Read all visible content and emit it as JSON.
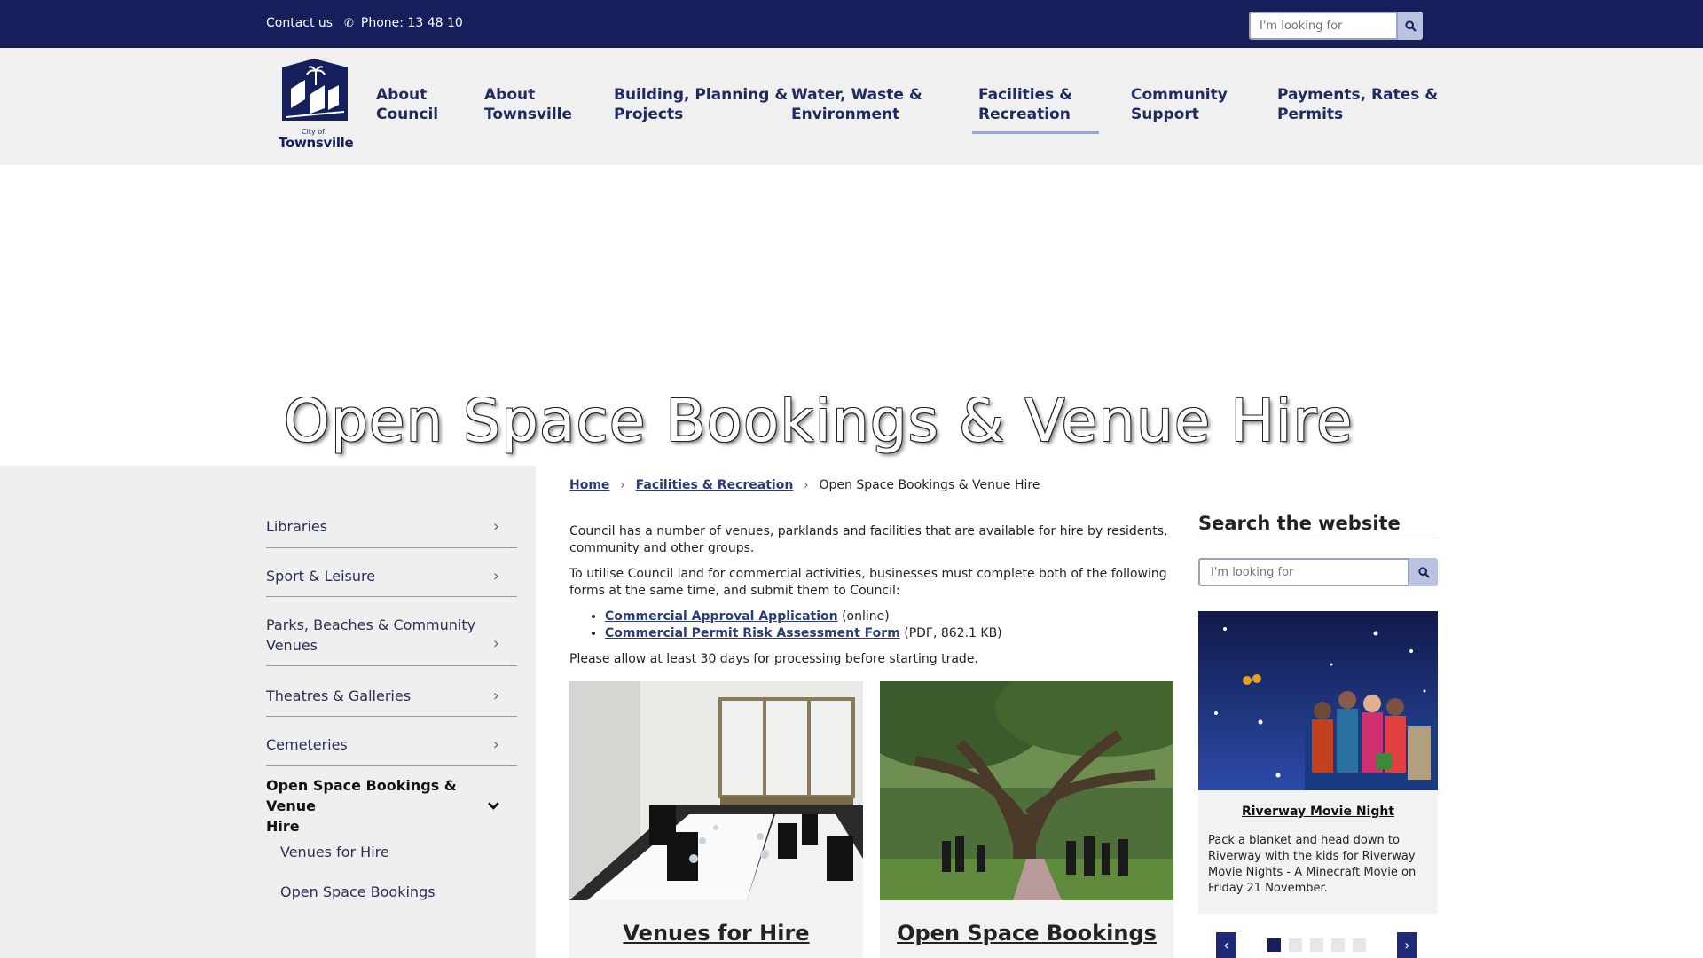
{
  "topbar": {
    "contact_label": "Contact us",
    "phone_label": "Phone: 13 48 10",
    "search_placeholder": "I'm looking for"
  },
  "logo": {
    "city_of": "City of",
    "town": "Townsville"
  },
  "nav": {
    "items": [
      {
        "line1": "About",
        "line2": "Council"
      },
      {
        "line1": "About",
        "line2": "Townsville"
      },
      {
        "line1": "Building, Planning &",
        "line2": "Projects"
      },
      {
        "line1": "Water, Waste &",
        "line2": "Environment"
      },
      {
        "line1": "Facilities &",
        "line2": "Recreation"
      },
      {
        "line1": "Community",
        "line2": "Support"
      },
      {
        "line1": "Payments, Rates &",
        "line2": "Permits"
      }
    ],
    "active_index": 4
  },
  "hero": {
    "title": "Open Space Bookings & Venue Hire"
  },
  "sidenav": {
    "items": [
      {
        "line1": "Libraries",
        "line2": ""
      },
      {
        "line1": "Sport & Leisure",
        "line2": ""
      },
      {
        "line1": "Parks, Beaches & Community",
        "line2": "Venues"
      },
      {
        "line1": "Theatres & Galleries",
        "line2": ""
      },
      {
        "line1": "Cemeteries",
        "line2": ""
      },
      {
        "line1": "Open Space Bookings & Venue",
        "line2": "Hire"
      }
    ],
    "sub_items": [
      "Venues for Hire",
      "Open Space Bookings"
    ]
  },
  "breadcrumb": {
    "home": "Home",
    "section": "Facilities & Recreation",
    "current": "Open Space Bookings & Venue Hire"
  },
  "content": {
    "intro": "Council has a number of venues, parklands and facilities that are available for hire by residents, community and other groups.",
    "commercial": "To utilise Council land for commercial activities, businesses must complete both of the following forms at the same time, and submit them to Council:",
    "links": [
      {
        "label": "Commercial Approval Application",
        "suffix": " (online)"
      },
      {
        "label": "Commercial Permit Risk Assessment Form",
        "suffix": " (PDF, 862.1 KB)"
      }
    ],
    "note": "Please allow at least 30 days for processing before starting trade."
  },
  "cards": [
    {
      "title": "Venues for Hire"
    },
    {
      "title": "Open Space Bookings"
    }
  ],
  "sidebar": {
    "search_heading": "Search the website",
    "search_placeholder": "I'm looking for",
    "promo_title": "Riverway Movie Night",
    "promo_desc": "Pack a blanket and head down to Riverway with the kids for Riverway Movie Nights - A Minecraft Movie on Friday 21 November.",
    "slide_count": 5,
    "active_slide": 1
  },
  "colors": {
    "brand_navy": "#141f5c",
    "link": "#2b3c78",
    "search_button": "#b9c3e0"
  }
}
